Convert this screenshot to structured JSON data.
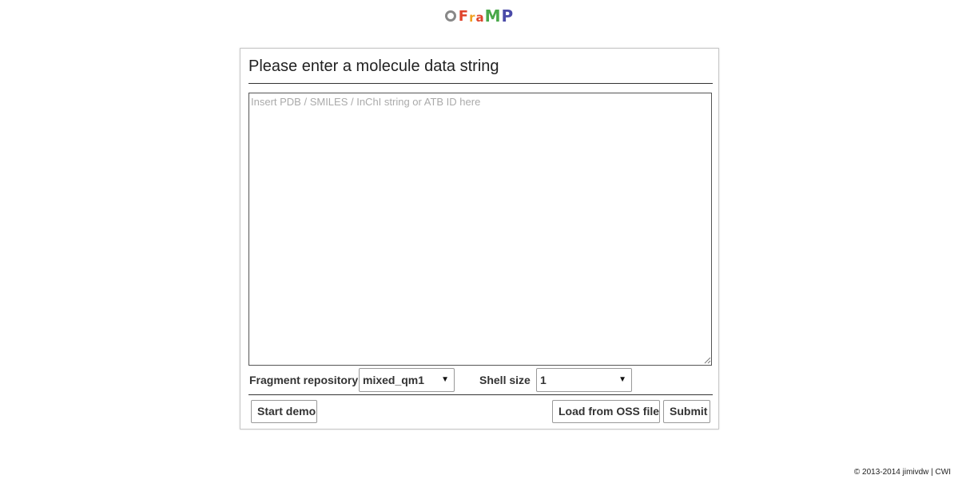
{
  "logo": {
    "letters": [
      {
        "char": "F",
        "color": "#e0442c"
      },
      {
        "char": "r",
        "color": "#f0a020"
      },
      {
        "char": "a",
        "color": "#e0442c"
      },
      {
        "char": "M",
        "color": "#4aa84a"
      },
      {
        "char": "P",
        "color": "#4a4aa8"
      }
    ],
    "ring_color": "#888888"
  },
  "panel": {
    "title": "Please enter a molecule data string",
    "input": {
      "value": "",
      "placeholder": "Insert PDB / SMILES / InChI string or ATB ID here"
    },
    "options": {
      "repository_label": "Fragment repository",
      "repository_value": "mixed_qm1",
      "shell_label": "Shell size",
      "shell_value": "1"
    },
    "buttons": {
      "demo": "Start demo",
      "load_oss": "Load from OSS file",
      "submit": "Submit"
    }
  },
  "footer": {
    "text": "© 2013-2014 jimivdw | CWI"
  }
}
